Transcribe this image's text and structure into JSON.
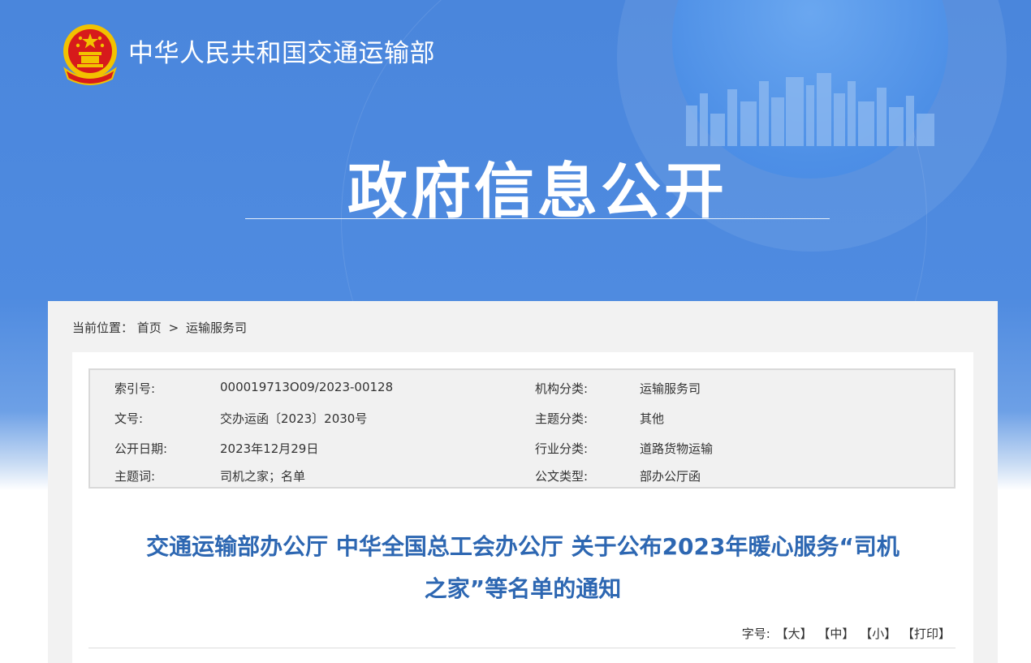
{
  "header": {
    "site_name": "中华人民共和国交通运输部",
    "section_title": "政府信息公开",
    "logo_icon": "national-emblem-icon"
  },
  "breadcrumb": {
    "prefix": "当前位置：",
    "home": "首页",
    "separator": ">",
    "current": "运输服务司"
  },
  "meta": {
    "rows": [
      {
        "label1": "索引号:",
        "value1": "000019713O09/2023-00128",
        "label2": "机构分类:",
        "value2": "运输服务司"
      },
      {
        "label1": "文号:",
        "value1": "交办运函〔2023〕2030号",
        "label2": "主题分类:",
        "value2": "其他"
      },
      {
        "label1": "公开日期:",
        "value1": "2023年12月29日",
        "label2": "行业分类:",
        "value2": "道路货物运输"
      },
      {
        "label1": "主题词:",
        "value1": "司机之家；名单",
        "label2": "公文类型:",
        "value2": "部办公厅函"
      }
    ]
  },
  "document": {
    "title_line1": "交通运输部办公厅 中华全国总工会办公厅 关于公布2023年暖心服务“司机",
    "title_line2": "之家”等名单的通知"
  },
  "font_tools": {
    "label": "字号:",
    "large": "【大】",
    "medium": "【中】",
    "small": "【小】",
    "print": "【打印】"
  },
  "colors": {
    "banner_blue": "#4a86dc",
    "title_blue": "#2d67b2",
    "emblem_red": "#d71a1b",
    "emblem_gold": "#f2c200"
  }
}
